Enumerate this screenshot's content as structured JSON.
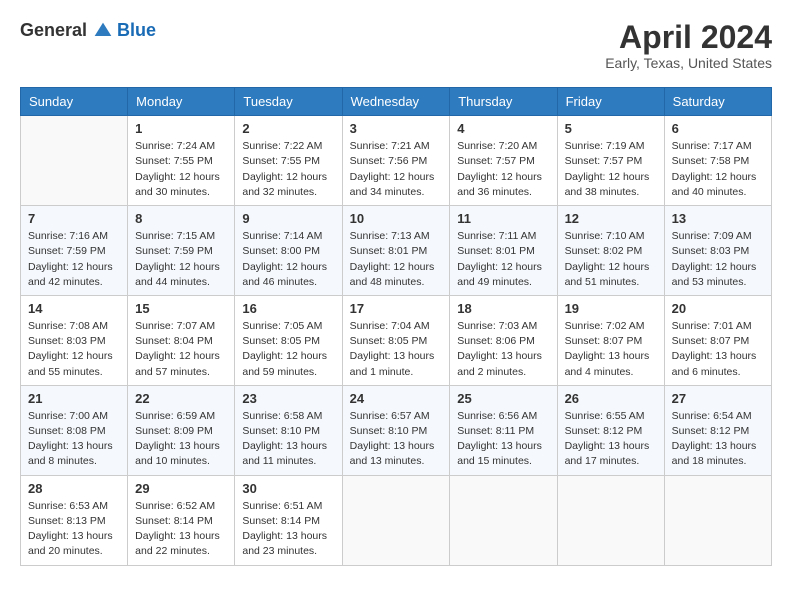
{
  "header": {
    "logo_general": "General",
    "logo_blue": "Blue",
    "month_title": "April 2024",
    "location": "Early, Texas, United States"
  },
  "days_of_week": [
    "Sunday",
    "Monday",
    "Tuesday",
    "Wednesday",
    "Thursday",
    "Friday",
    "Saturday"
  ],
  "weeks": [
    [
      {
        "day": "",
        "info": ""
      },
      {
        "day": "1",
        "info": "Sunrise: 7:24 AM\nSunset: 7:55 PM\nDaylight: 12 hours\nand 30 minutes."
      },
      {
        "day": "2",
        "info": "Sunrise: 7:22 AM\nSunset: 7:55 PM\nDaylight: 12 hours\nand 32 minutes."
      },
      {
        "day": "3",
        "info": "Sunrise: 7:21 AM\nSunset: 7:56 PM\nDaylight: 12 hours\nand 34 minutes."
      },
      {
        "day": "4",
        "info": "Sunrise: 7:20 AM\nSunset: 7:57 PM\nDaylight: 12 hours\nand 36 minutes."
      },
      {
        "day": "5",
        "info": "Sunrise: 7:19 AM\nSunset: 7:57 PM\nDaylight: 12 hours\nand 38 minutes."
      },
      {
        "day": "6",
        "info": "Sunrise: 7:17 AM\nSunset: 7:58 PM\nDaylight: 12 hours\nand 40 minutes."
      }
    ],
    [
      {
        "day": "7",
        "info": "Sunrise: 7:16 AM\nSunset: 7:59 PM\nDaylight: 12 hours\nand 42 minutes."
      },
      {
        "day": "8",
        "info": "Sunrise: 7:15 AM\nSunset: 7:59 PM\nDaylight: 12 hours\nand 44 minutes."
      },
      {
        "day": "9",
        "info": "Sunrise: 7:14 AM\nSunset: 8:00 PM\nDaylight: 12 hours\nand 46 minutes."
      },
      {
        "day": "10",
        "info": "Sunrise: 7:13 AM\nSunset: 8:01 PM\nDaylight: 12 hours\nand 48 minutes."
      },
      {
        "day": "11",
        "info": "Sunrise: 7:11 AM\nSunset: 8:01 PM\nDaylight: 12 hours\nand 49 minutes."
      },
      {
        "day": "12",
        "info": "Sunrise: 7:10 AM\nSunset: 8:02 PM\nDaylight: 12 hours\nand 51 minutes."
      },
      {
        "day": "13",
        "info": "Sunrise: 7:09 AM\nSunset: 8:03 PM\nDaylight: 12 hours\nand 53 minutes."
      }
    ],
    [
      {
        "day": "14",
        "info": "Sunrise: 7:08 AM\nSunset: 8:03 PM\nDaylight: 12 hours\nand 55 minutes."
      },
      {
        "day": "15",
        "info": "Sunrise: 7:07 AM\nSunset: 8:04 PM\nDaylight: 12 hours\nand 57 minutes."
      },
      {
        "day": "16",
        "info": "Sunrise: 7:05 AM\nSunset: 8:05 PM\nDaylight: 12 hours\nand 59 minutes."
      },
      {
        "day": "17",
        "info": "Sunrise: 7:04 AM\nSunset: 8:05 PM\nDaylight: 13 hours\nand 1 minute."
      },
      {
        "day": "18",
        "info": "Sunrise: 7:03 AM\nSunset: 8:06 PM\nDaylight: 13 hours\nand 2 minutes."
      },
      {
        "day": "19",
        "info": "Sunrise: 7:02 AM\nSunset: 8:07 PM\nDaylight: 13 hours\nand 4 minutes."
      },
      {
        "day": "20",
        "info": "Sunrise: 7:01 AM\nSunset: 8:07 PM\nDaylight: 13 hours\nand 6 minutes."
      }
    ],
    [
      {
        "day": "21",
        "info": "Sunrise: 7:00 AM\nSunset: 8:08 PM\nDaylight: 13 hours\nand 8 minutes."
      },
      {
        "day": "22",
        "info": "Sunrise: 6:59 AM\nSunset: 8:09 PM\nDaylight: 13 hours\nand 10 minutes."
      },
      {
        "day": "23",
        "info": "Sunrise: 6:58 AM\nSunset: 8:10 PM\nDaylight: 13 hours\nand 11 minutes."
      },
      {
        "day": "24",
        "info": "Sunrise: 6:57 AM\nSunset: 8:10 PM\nDaylight: 13 hours\nand 13 minutes."
      },
      {
        "day": "25",
        "info": "Sunrise: 6:56 AM\nSunset: 8:11 PM\nDaylight: 13 hours\nand 15 minutes."
      },
      {
        "day": "26",
        "info": "Sunrise: 6:55 AM\nSunset: 8:12 PM\nDaylight: 13 hours\nand 17 minutes."
      },
      {
        "day": "27",
        "info": "Sunrise: 6:54 AM\nSunset: 8:12 PM\nDaylight: 13 hours\nand 18 minutes."
      }
    ],
    [
      {
        "day": "28",
        "info": "Sunrise: 6:53 AM\nSunset: 8:13 PM\nDaylight: 13 hours\nand 20 minutes."
      },
      {
        "day": "29",
        "info": "Sunrise: 6:52 AM\nSunset: 8:14 PM\nDaylight: 13 hours\nand 22 minutes."
      },
      {
        "day": "30",
        "info": "Sunrise: 6:51 AM\nSunset: 8:14 PM\nDaylight: 13 hours\nand 23 minutes."
      },
      {
        "day": "",
        "info": ""
      },
      {
        "day": "",
        "info": ""
      },
      {
        "day": "",
        "info": ""
      },
      {
        "day": "",
        "info": ""
      }
    ]
  ]
}
